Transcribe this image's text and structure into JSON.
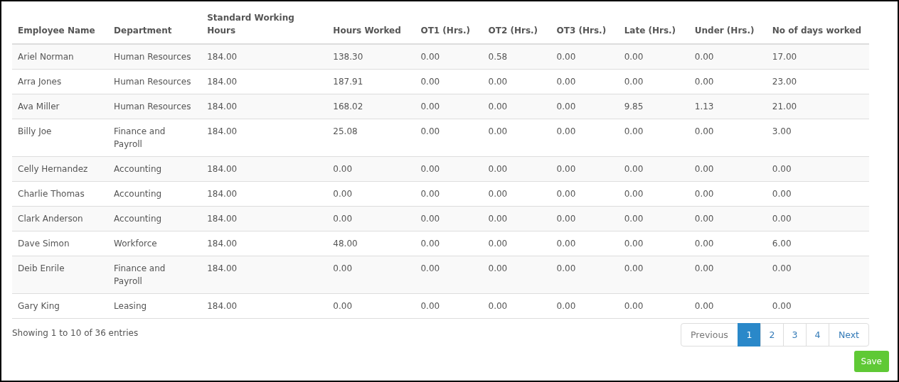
{
  "table": {
    "columns": [
      "Employee Name",
      "Department",
      "Standard Working Hours",
      "Hours Worked",
      "OT1 (Hrs.)",
      "OT2 (Hrs.)",
      "OT3 (Hrs.)",
      "Late (Hrs.)",
      "Under (Hrs.)",
      "No of days worked"
    ],
    "rows": [
      [
        "Ariel Norman",
        "Human Resources",
        "184.00",
        "138.30",
        "0.00",
        "0.58",
        "0.00",
        "0.00",
        "0.00",
        "17.00"
      ],
      [
        "Arra Jones",
        "Human Resources",
        "184.00",
        "187.91",
        "0.00",
        "0.00",
        "0.00",
        "0.00",
        "0.00",
        "23.00"
      ],
      [
        "Ava Miller",
        "Human Resources",
        "184.00",
        "168.02",
        "0.00",
        "0.00",
        "0.00",
        "9.85",
        "1.13",
        "21.00"
      ],
      [
        "Billy Joe",
        "Finance and Payroll",
        "184.00",
        "25.08",
        "0.00",
        "0.00",
        "0.00",
        "0.00",
        "0.00",
        "3.00"
      ],
      [
        "Celly Hernandez",
        "Accounting",
        "184.00",
        "0.00",
        "0.00",
        "0.00",
        "0.00",
        "0.00",
        "0.00",
        "0.00"
      ],
      [
        "Charlie Thomas",
        "Accounting",
        "184.00",
        "0.00",
        "0.00",
        "0.00",
        "0.00",
        "0.00",
        "0.00",
        "0.00"
      ],
      [
        "Clark Anderson",
        "Accounting",
        "184.00",
        "0.00",
        "0.00",
        "0.00",
        "0.00",
        "0.00",
        "0.00",
        "0.00"
      ],
      [
        "Dave Simon",
        "Workforce",
        "184.00",
        "48.00",
        "0.00",
        "0.00",
        "0.00",
        "0.00",
        "0.00",
        "6.00"
      ],
      [
        "Deib Enrile",
        "Finance and Payroll",
        "184.00",
        "0.00",
        "0.00",
        "0.00",
        "0.00",
        "0.00",
        "0.00",
        "0.00"
      ],
      [
        "Gary King",
        "Leasing",
        "184.00",
        "0.00",
        "0.00",
        "0.00",
        "0.00",
        "0.00",
        "0.00",
        "0.00"
      ]
    ]
  },
  "info": "Showing 1 to 10 of 36 entries",
  "pagination": [
    {
      "label": "Previous",
      "selected": false,
      "disabled": true
    },
    {
      "label": "1",
      "selected": true,
      "disabled": false
    },
    {
      "label": "2",
      "selected": false,
      "disabled": false
    },
    {
      "label": "3",
      "selected": false,
      "disabled": false
    },
    {
      "label": "4",
      "selected": false,
      "disabled": false
    },
    {
      "label": "Next",
      "selected": false,
      "disabled": false
    }
  ],
  "save_button": "Save"
}
